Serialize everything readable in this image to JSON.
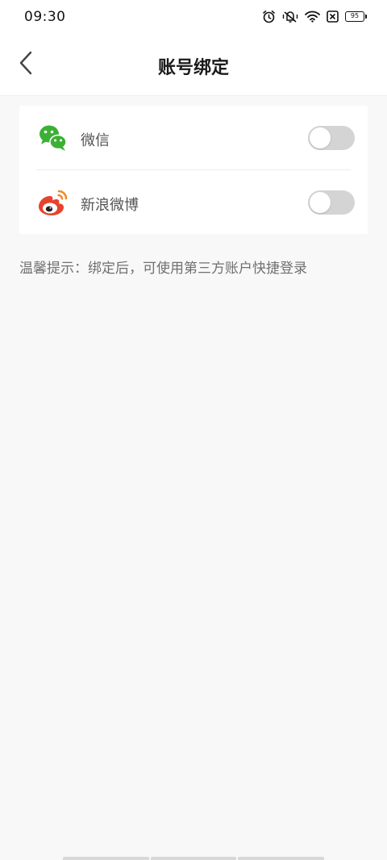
{
  "status_bar": {
    "time": "09:30",
    "battery": "95",
    "icons": [
      "alarm-icon",
      "vibrate-mute-icon",
      "wifi-icon",
      "sim-blocked-icon",
      "battery-icon"
    ]
  },
  "header": {
    "title": "账号绑定",
    "back_icon": "chevron-left-icon"
  },
  "bindings": [
    {
      "label": "微信",
      "icon": "wechat-icon",
      "enabled": false,
      "brand_color": "#3cb034"
    },
    {
      "label": "新浪微博",
      "icon": "weibo-icon",
      "enabled": false,
      "brand_color": "#e6432e"
    }
  ],
  "hint": "温馨提示：绑定后，可使用第三方账户快捷登录",
  "colors": {
    "background": "#f8f8f8",
    "toggle_off": "#d4d4d4"
  }
}
